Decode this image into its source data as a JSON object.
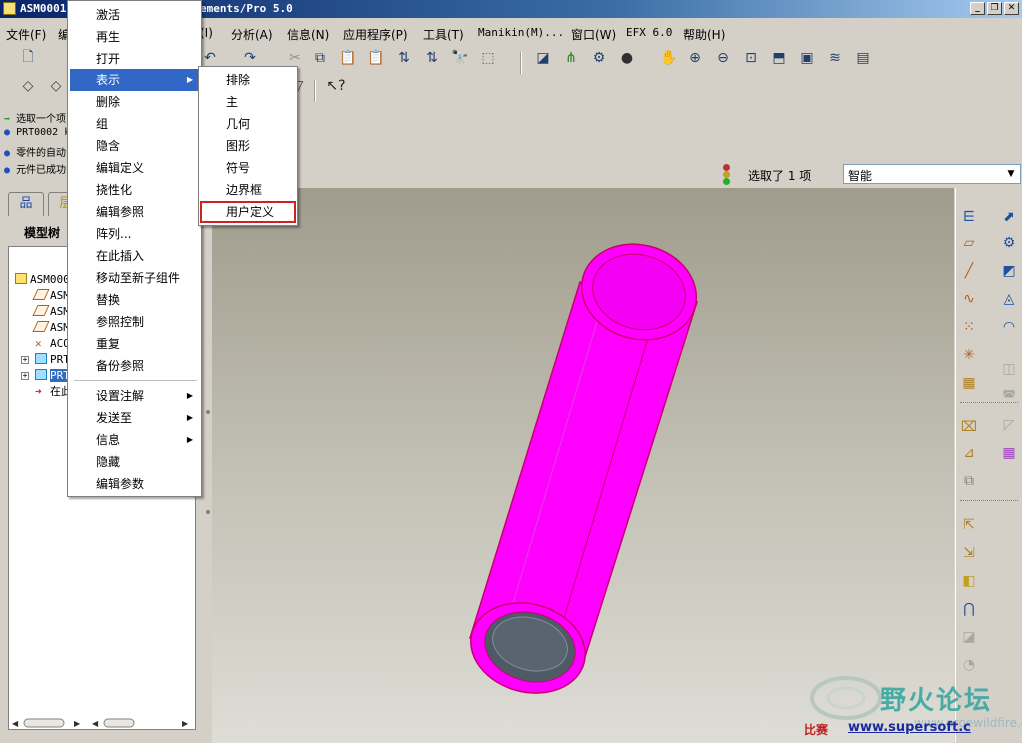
{
  "window": {
    "title_left": "ASM0001",
    "title_right": "ements/Pro 5.0",
    "btn_min": "_",
    "btn_restore": "❐",
    "btn_close": "✕"
  },
  "menubar": [
    {
      "label": "文件(F)"
    },
    {
      "label": "编"
    },
    {
      "label": "(I)"
    },
    {
      "label": "分析(A)"
    },
    {
      "label": "信息(N)"
    },
    {
      "label": "应用程序(P)"
    },
    {
      "label": "工具(T)"
    },
    {
      "label": "Manikin(M)..."
    },
    {
      "label": "窗口(W)"
    },
    {
      "label": "EFX 6.0"
    },
    {
      "label": "帮助(H)"
    }
  ],
  "messages": [
    {
      "text": "选取一个项"
    },
    {
      "text": "PRT0002 k"
    },
    {
      "text": "零件的自动"
    },
    {
      "text": "元件已成功"
    }
  ],
  "status": {
    "selection_text": "选取了 1 项",
    "filter_value": "智能"
  },
  "left_panel": {
    "tab_model_tree": "品",
    "tab_layers": "层",
    "tree_title": "模型树",
    "tree_items": [
      {
        "label": "ASM000"
      },
      {
        "label": "ASM"
      },
      {
        "label": "ASM"
      },
      {
        "label": "ASM"
      },
      {
        "label": "ACO"
      },
      {
        "label": "PRT"
      },
      {
        "label": "PRT"
      },
      {
        "label": "在此"
      }
    ]
  },
  "context_menu": {
    "items": [
      {
        "label": "激活"
      },
      {
        "label": "再生"
      },
      {
        "label": "打开"
      },
      {
        "label": "表示"
      },
      {
        "label": "删除"
      },
      {
        "label": "组"
      },
      {
        "label": "隐含"
      },
      {
        "label": "编辑定义"
      },
      {
        "label": "挠性化"
      },
      {
        "label": "编辑参照"
      },
      {
        "label": "阵列..."
      },
      {
        "label": "在此插入"
      },
      {
        "label": "移动至新子组件"
      },
      {
        "label": "替换"
      },
      {
        "label": "参照控制"
      },
      {
        "label": "重复"
      },
      {
        "label": "备份参照"
      },
      {
        "label": "设置注解"
      },
      {
        "label": "发送至"
      },
      {
        "label": "信息"
      },
      {
        "label": "隐藏"
      },
      {
        "label": "编辑参数"
      }
    ]
  },
  "submenu": {
    "items": [
      {
        "label": "排除"
      },
      {
        "label": "主"
      },
      {
        "label": "几何"
      },
      {
        "label": "图形"
      },
      {
        "label": "符号"
      },
      {
        "label": "边界框"
      },
      {
        "label": "用户定义"
      }
    ]
  },
  "watermark": {
    "title": "野火论坛",
    "url": "www.proewildfire.cn",
    "left_text": "比赛",
    "link_text": "www.supersoft.c"
  },
  "colors": {
    "part": "#ff00ff",
    "part_edge": "#c8006e",
    "highlight": "#3168c5",
    "box": "#d02020"
  }
}
